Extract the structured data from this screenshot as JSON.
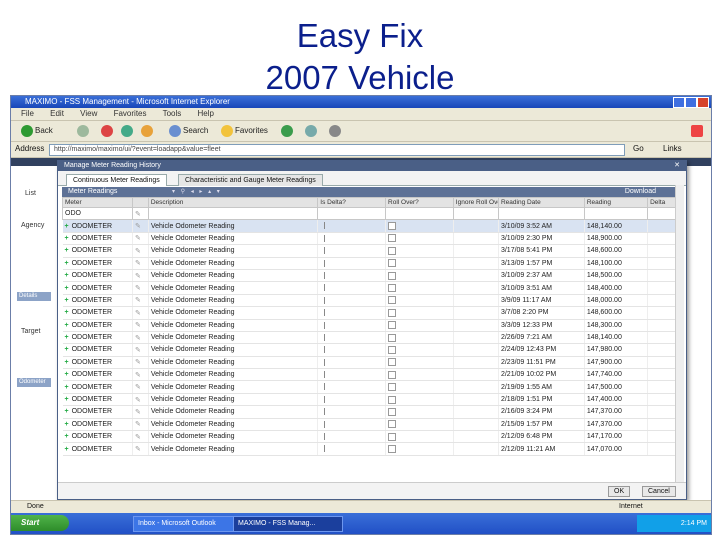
{
  "slide": {
    "title_line1": "Easy Fix",
    "title_line2": "2007 Vehicle"
  },
  "browser": {
    "window_title": "MAXIMO - FSS Management - Microsoft Internet Explorer",
    "menu": [
      "File",
      "Edit",
      "View",
      "Favorites",
      "Tools",
      "Help"
    ],
    "toolbar": {
      "back": "Back",
      "search": "Search",
      "favorites": "Favorites"
    },
    "address_label": "Address",
    "address_value": "http://maximo/maximo/ui/?event=loadapp&value=fleet",
    "go_label": "Go",
    "links_label": "Links"
  },
  "background_form": {
    "agency_label": "Agency",
    "details_band": "Details",
    "target_label": "Target",
    "odometer_band": "Odometer",
    "list_tab": "List"
  },
  "dialog": {
    "title": "Manage Meter Reading History",
    "tabs": [
      "Continuous Meter Readings",
      "Characteristic and Gauge Meter Readings"
    ],
    "section_title": "Meter Readings",
    "download_label": "Download",
    "columns": [
      "Meter",
      "Description",
      "Is Delta?",
      "Roll Over?",
      "Ignore Roll Over?",
      "Reading Date",
      "Reading",
      "Delta"
    ],
    "filter_meter": "ODO",
    "rows": [
      {
        "meter": "ODOMETER",
        "description": "Vehicle Odometer Reading",
        "date": "3/10/09 3:52 AM",
        "reading": "148,140.00",
        "delta": ""
      },
      {
        "meter": "ODOMETER",
        "description": "Vehicle Odometer Reading",
        "date": "3/10/09 2:30 PM",
        "reading": "148,900.00",
        "delta": ""
      },
      {
        "meter": "ODOMETER",
        "description": "Vehicle Odometer Reading",
        "date": "3/17/08 5:41 PM",
        "reading": "148,600.00",
        "delta": ""
      },
      {
        "meter": "ODOMETER",
        "description": "Vehicle Odometer Reading",
        "date": "3/13/09 1:57 PM",
        "reading": "148,100.00",
        "delta": ""
      },
      {
        "meter": "ODOMETER",
        "description": "Vehicle Odometer Reading",
        "date": "3/10/09 2:37 AM",
        "reading": "148,500.00",
        "delta": ""
      },
      {
        "meter": "ODOMETER",
        "description": "Vehicle Odometer Reading",
        "date": "3/10/09 3:51 AM",
        "reading": "148,400.00",
        "delta": ""
      },
      {
        "meter": "ODOMETER",
        "description": "Vehicle Odometer Reading",
        "date": "3/9/09 11:17 AM",
        "reading": "148,000.00",
        "delta": ""
      },
      {
        "meter": "ODOMETER",
        "description": "Vehicle Odometer Reading",
        "date": "3/7/08 2:20 PM",
        "reading": "148,600.00",
        "delta": ""
      },
      {
        "meter": "ODOMETER",
        "description": "Vehicle Odometer Reading",
        "date": "3/3/09 12:33 PM",
        "reading": "148,300.00",
        "delta": ""
      },
      {
        "meter": "ODOMETER",
        "description": "Vehicle Odometer Reading",
        "date": "2/26/09 7:21 AM",
        "reading": "148,140.00",
        "delta": ""
      },
      {
        "meter": "ODOMETER",
        "description": "Vehicle Odometer Reading",
        "date": "2/24/09 12:43 PM",
        "reading": "147,980.00",
        "delta": ""
      },
      {
        "meter": "ODOMETER",
        "description": "Vehicle Odometer Reading",
        "date": "2/23/09 11:51 PM",
        "reading": "147,900.00",
        "delta": ""
      },
      {
        "meter": "ODOMETER",
        "description": "Vehicle Odometer Reading",
        "date": "2/21/09 10:02 PM",
        "reading": "147,740.00",
        "delta": ""
      },
      {
        "meter": "ODOMETER",
        "description": "Vehicle Odometer Reading",
        "date": "2/19/09 1:55 AM",
        "reading": "147,500.00",
        "delta": ""
      },
      {
        "meter": "ODOMETER",
        "description": "Vehicle Odometer Reading",
        "date": "2/18/09 1:51 PM",
        "reading": "147,400.00",
        "delta": ""
      },
      {
        "meter": "ODOMETER",
        "description": "Vehicle Odometer Reading",
        "date": "2/16/09 3:24 PM",
        "reading": "147,370.00",
        "delta": ""
      },
      {
        "meter": "ODOMETER",
        "description": "Vehicle Odometer Reading",
        "date": "2/15/09 1:57 PM",
        "reading": "147,370.00",
        "delta": ""
      },
      {
        "meter": "ODOMETER",
        "description": "Vehicle Odometer Reading",
        "date": "2/12/09 6:48 PM",
        "reading": "147,170.00",
        "delta": ""
      },
      {
        "meter": "ODOMETER",
        "description": "Vehicle Odometer Reading",
        "date": "2/12/09 11:21 AM",
        "reading": "147,070.00",
        "delta": ""
      }
    ],
    "ok_label": "OK",
    "cancel_label": "Cancel"
  },
  "status": {
    "left": "Done",
    "zone": "Internet"
  },
  "taskbar": {
    "start": "Start",
    "tasks": [
      "Inbox - Microsoft Outlook",
      "MAXIMO - FSS Manag..."
    ],
    "clock": "2:14 PM"
  }
}
